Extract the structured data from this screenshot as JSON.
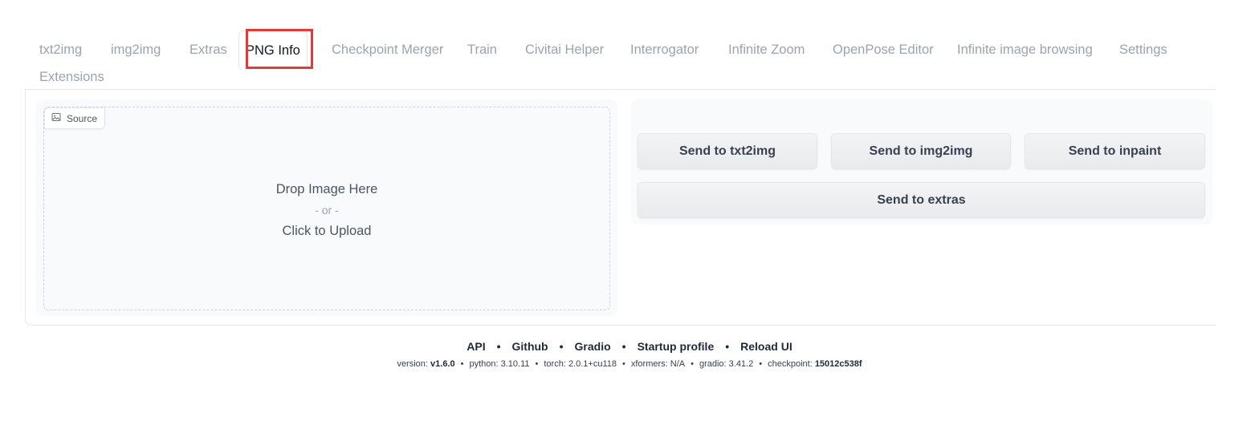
{
  "tabs": [
    {
      "label": "txt2img"
    },
    {
      "label": "img2img"
    },
    {
      "label": "Extras"
    },
    {
      "label": "PNG Info",
      "selected": true
    },
    {
      "label": "Checkpoint Merger"
    },
    {
      "label": "Train"
    },
    {
      "label": "Civitai Helper"
    },
    {
      "label": "Interrogator"
    },
    {
      "label": "Infinite Zoom"
    },
    {
      "label": "OpenPose Editor"
    },
    {
      "label": "Infinite image browsing"
    },
    {
      "label": "Settings"
    },
    {
      "label": "Extensions"
    }
  ],
  "source": {
    "label": "Source",
    "icon": "image-icon",
    "drop_text": "Drop Image Here",
    "or_text": "- or -",
    "click_text": "Click to Upload"
  },
  "actions": {
    "send_txt2img": "Send to txt2img",
    "send_img2img": "Send to img2img",
    "send_inpaint": "Send to inpaint",
    "send_extras": "Send to extras"
  },
  "footer": {
    "links": [
      "API",
      "Github",
      "Gradio",
      "Startup profile",
      "Reload UI"
    ],
    "versions": {
      "version_label": "version:",
      "version_value": "v1.6.0",
      "python": "python: 3.10.11",
      "torch": "torch: 2.0.1+cu118",
      "xformers": "xformers: N/A",
      "gradio": "gradio: 3.41.2",
      "checkpoint_label": "checkpoint:",
      "checkpoint_value": "15012c538f"
    }
  },
  "highlight_color": "#e53935"
}
